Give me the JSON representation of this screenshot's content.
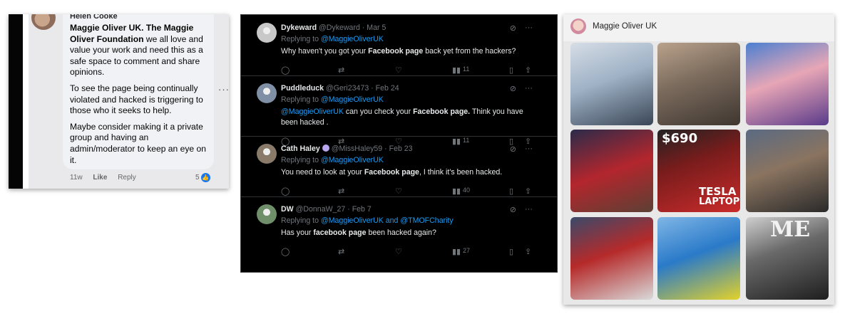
{
  "facebook_comment": {
    "author": "Helen Cooke",
    "paragraphs": [
      {
        "bold": "Maggie Oliver UK. The Maggie Oliver Foundation",
        "text": " we all love and value your work and need this as a safe space to comment and share opinions."
      },
      {
        "bold": "",
        "text": "To see the page being continually violated and hacked is triggering to those who it seeks to help."
      },
      {
        "bold": "",
        "text": "Maybe consider making it a private group and having an admin/moderator to keep an eye on it."
      }
    ],
    "more": "···",
    "time": "11w",
    "like": "Like",
    "reply": "Reply",
    "reaction_count": "5"
  },
  "tweets": [
    {
      "name": "Dykeward",
      "handle": "@Dykeward",
      "date": "Mar 5",
      "replying_prefix": "Replying to ",
      "replying_to": "@MaggieOliverUK",
      "body": "Why haven't you got your <b>Facebook page</b> back yet from the hackers?",
      "views": "11",
      "avatar_color": "#c8c8c8"
    },
    {
      "name": "Puddleduck",
      "handle": "@Geri23473",
      "date": "Feb 24",
      "replying_prefix": "Replying to ",
      "replying_to": "@MaggieOliverUK",
      "body": "<span class=\"mention\">@MaggieOliverUK</span>  can you check your <b>Facebook page.</b> Think you have been hacked .",
      "views": "11",
      "avatar_color": "#7f8fa6"
    },
    {
      "name": "Cath Haley",
      "handle": "@MissHaley59",
      "date": "Feb 23",
      "replying_prefix": "Replying to ",
      "replying_to": "@MaggieOliverUK",
      "body": "You need to look at your <b>Facebook page</b>, I think it's been hacked.",
      "views": "40",
      "avatar_color": "#8a7a6a"
    },
    {
      "name": "DW",
      "handle": "@DonnaW_27",
      "date": "Feb 7",
      "replying_prefix": "Replying to ",
      "replying_to": "@MaggieOliverUK and @TMOFCharity",
      "body": "Has your <b>facebook page</b> been hacked again?",
      "views": "27",
      "avatar_color": "#6f8f6a"
    }
  ],
  "profile_grid": {
    "name": "Maggie Oliver UK",
    "tiles": [
      {
        "bg": "linear-gradient(160deg,#d6dde6 0%,#9fb2c6 45%,#3a4656 100%)",
        "label": ""
      },
      {
        "bg": "linear-gradient(160deg,#b9a28c 0%,#7a6a5c 45%,#3e3630 100%)",
        "label": ""
      },
      {
        "bg": "linear-gradient(160deg,#4b7fd1 0%,#e7a6b6 45%,#5a3a8a 100%)",
        "label": ""
      },
      {
        "bg": "linear-gradient(160deg,#2b2b4a 0%,#b3262d 50%,#5c4034 100%)",
        "label": ""
      },
      {
        "bg": "linear-gradient(160deg,#222 0%,#7a1c1c 40%,#c92b2b 100%)",
        "label": "$690"
      },
      {
        "bg": "linear-gradient(160deg,#5a6a82 0%,#8a7460 45%,#2a2a2a 100%)",
        "label": ""
      },
      {
        "bg": "linear-gradient(160deg,#3a4a6a 0%,#b62a2a 45%,#d9d9d9 100%)",
        "label": ""
      },
      {
        "bg": "linear-gradient(160deg,#7fb6e6 0%,#2a7ac9 45%,#e2d12a 100%)",
        "label": ""
      },
      {
        "bg": "linear-gradient(160deg,#cfcfcf 0%,#6a6a6a 40%,#1e1e1e 100%)",
        "label": "ME"
      }
    ],
    "laptop_title": "TESLA",
    "laptop_sub": "LAPTOP"
  }
}
